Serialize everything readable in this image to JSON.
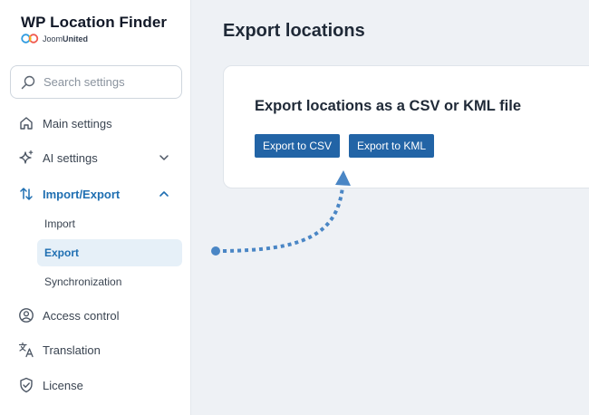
{
  "brand": {
    "title": "WP Location Finder",
    "company_prefix": "Joom",
    "company_suffix": "United"
  },
  "search": {
    "placeholder": "Search settings"
  },
  "sidebar": {
    "items": [
      {
        "label": "Main settings",
        "icon": "home-icon"
      },
      {
        "label": "AI settings",
        "icon": "sparkle-icon"
      },
      {
        "label": "Import/Export",
        "icon": "import-export-icon"
      },
      {
        "label": "Access control",
        "icon": "user-circle-icon"
      },
      {
        "label": "Translation",
        "icon": "translate-icon"
      },
      {
        "label": "License",
        "icon": "shield-check-icon"
      }
    ],
    "sub_items": [
      {
        "label": "Import"
      },
      {
        "label": "Export"
      },
      {
        "label": "Synchronization"
      }
    ]
  },
  "page": {
    "title": "Export locations"
  },
  "card": {
    "heading": "Export locations as a CSV or KML file",
    "buttons": {
      "csv": "Export to CSV",
      "kml": "Export to KML"
    }
  },
  "colors": {
    "accent": "#1f6fb2",
    "button": "#2264a6",
    "selected_bg": "#e6f0f8",
    "annotation": "#4a86c5"
  }
}
